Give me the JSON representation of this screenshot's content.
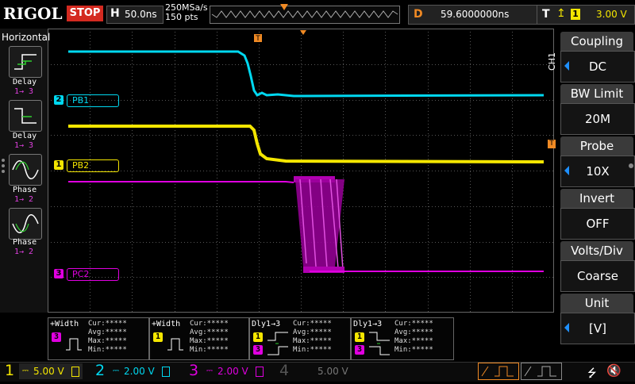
{
  "topbar": {
    "logo": "RIGOL",
    "run_state": "STOP",
    "horizontal_key": "H",
    "timebase": "50.0ns",
    "sample_rate": "250MSa/s",
    "points": "150 pts",
    "delay_key": "D",
    "delay_value": "59.6000000ns",
    "trigger_key": "T",
    "trigger_edge_icon": "rising-edge-icon",
    "trigger_source": "1",
    "trigger_level": "3.00 V"
  },
  "left_panel": {
    "title": "Horizontal",
    "items": [
      {
        "label": "Delay",
        "sub": "1→ 3",
        "icon": "delay-rising-icon"
      },
      {
        "label": "Delay",
        "sub": "1→ 3",
        "icon": "delay-falling-icon"
      },
      {
        "label": "Phase",
        "sub": "1→ 2",
        "icon": "phase-rising-icon"
      },
      {
        "label": "Phase",
        "sub": "1→ 2",
        "icon": "phase-falling-icon"
      }
    ]
  },
  "traces": {
    "ch1_label": "PB2",
    "ch1_num": "1",
    "ch2_label": "PB1",
    "ch2_num": "2",
    "ch3_label": "PC2",
    "ch3_num": "3"
  },
  "right_panel": {
    "side_label": "CH1",
    "items": [
      {
        "title": "Coupling",
        "value": "DC"
      },
      {
        "title": "BW Limit",
        "value": "20M"
      },
      {
        "title": "Probe",
        "value": "10X"
      },
      {
        "title": "Invert",
        "value": "OFF"
      },
      {
        "title": "Volts/Div",
        "value": "Coarse"
      },
      {
        "title": "Unit",
        "value": "[V]"
      }
    ]
  },
  "measurements": [
    {
      "title": "+Width",
      "ch": "3",
      "cur": "Cur:*****",
      "avg": "Avg:*****",
      "max": "Max:*****",
      "min": "Min:*****"
    },
    {
      "title": "+Width",
      "ch": "1",
      "cur": "Cur:*****",
      "avg": "Avg:*****",
      "max": "Max:*****",
      "min": "Min:*****"
    },
    {
      "title": "Dly1→3",
      "ch_a": "1",
      "ch_b": "3",
      "cur": "Cur:*****",
      "avg": "Avg:*****",
      "max": "Max:*****",
      "min": "Min:*****"
    },
    {
      "title": "Dly1→3",
      "ch_a": "1",
      "ch_b": "3",
      "cur": "Cur:*****",
      "avg": "Avg:*****",
      "max": "Max:*****",
      "min": "Min:*****"
    }
  ],
  "bottom": {
    "ch1_num": "1",
    "ch1_scale": "5.00 V",
    "ch2_num": "2",
    "ch2_scale": "2.00 V",
    "ch3_num": "3",
    "ch3_scale": "2.00 V",
    "ch4_num": "4",
    "ch4_scale": "5.00 V"
  },
  "colors": {
    "ch1": "#f4e600",
    "ch2": "#00d8f0",
    "ch3": "#e000e0",
    "ch4": "#3a5cff",
    "trigger": "#f08a24"
  }
}
